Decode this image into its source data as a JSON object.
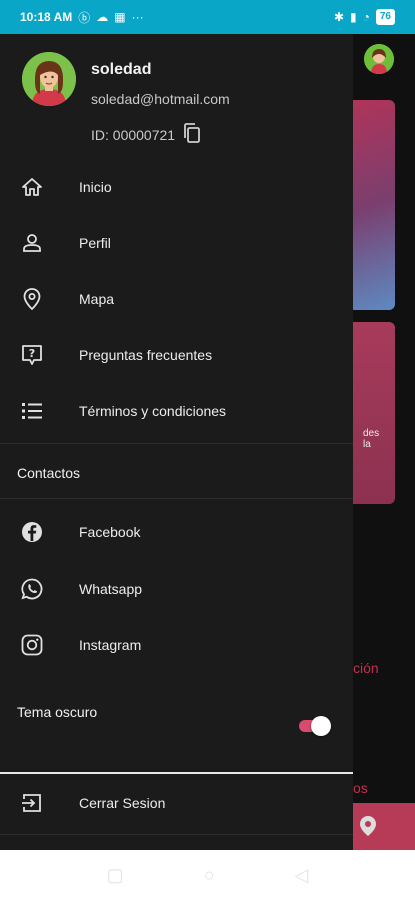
{
  "status_bar": {
    "time": "10:18 AM",
    "battery": "76",
    "colors": {
      "background": "#0aa6c8"
    }
  },
  "profile": {
    "name": "soledad",
    "email": "soledad@hotmail.com",
    "id_label": "ID: 00000721"
  },
  "menu": [
    {
      "label": "Inicio",
      "icon": "home-icon"
    },
    {
      "label": "Perfil",
      "icon": "person-icon"
    },
    {
      "label": "Mapa",
      "icon": "location-pin-icon"
    },
    {
      "label": "Preguntas frecuentes",
      "icon": "help-chat-icon"
    },
    {
      "label": "Términos y condiciones",
      "icon": "list-icon"
    }
  ],
  "contacts": {
    "title": "Contactos",
    "items": [
      {
        "label": "Facebook",
        "icon": "facebook-icon"
      },
      {
        "label": "Whatsapp",
        "icon": "whatsapp-icon"
      },
      {
        "label": "Instagram",
        "icon": "instagram-icon"
      }
    ]
  },
  "dark_theme": {
    "label": "Tema oscuro",
    "enabled": true,
    "accent": "#d84a6e"
  },
  "logout": {
    "label": "Cerrar Sesion",
    "icon": "logout-icon"
  },
  "background_app": {
    "card_text": "des\nla",
    "link1": "ción",
    "link2": "os"
  }
}
